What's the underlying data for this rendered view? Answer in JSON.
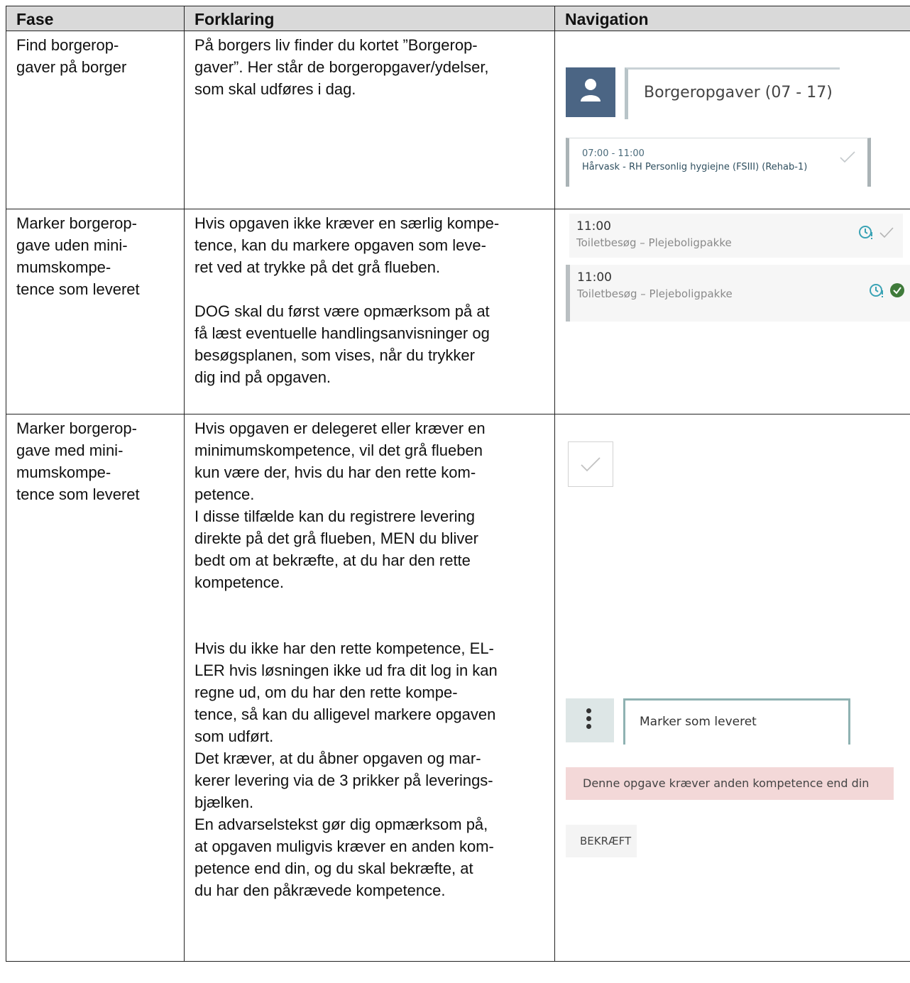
{
  "table": {
    "headers": [
      "Fase",
      "Forklaring",
      "Navigation"
    ],
    "rows": [
      {
        "fase": "Find borgerop-\ngaver på borger",
        "forklaring": [
          "På borgers liv finder du kortet ”Borgerop-\ngaver”. Her står de borgeropgaver/ydelser,\nsom skal udføres i dag."
        ]
      },
      {
        "fase": "Marker borgerop-\ngave uden mini-\nmumskompe-\ntence som leveret",
        "forklaring": [
          "Hvis opgaven ikke kræver en særlig kompe-\ntence, kan du markere opgaven som leve-\nret ved at trykke på det grå flueben.",
          "DOG skal du først være opmærksom på at\nfå læst eventuelle handlingsanvisninger og\nbesøgsplanen, som vises, når du trykker\ndig ind på opgaven."
        ]
      },
      {
        "fase": "Marker borgerop-\ngave med mini-\nmumskompe-\ntence som leveret",
        "forklaring": [
          "Hvis opgaven er delegeret eller kræver en\nminimumskompetence, vil det grå flueben\nkun være der, hvis du har den rette kom-\npetence.\nI disse tilfælde kan du registrere levering\ndirekte på det grå flueben, MEN du bliver\nbedt om at bekræfte, at du har den rette\nkompetence.",
          "Hvis du ikke har den rette kompetence, EL-\nLER hvis løsningen ikke ud fra dit log in kan\nregne ud, om du har den rette kompe-\ntence, så kan du alligevel markere opgaven\nsom udført.\nDet kræver, at du åbner opgaven og mar-\nkerer levering via de 3 prikker på leverings-\nbjælken.\nEn advarselstekst gør dig opmærksom på,\nat opgaven muligvis kræver en anden kom-\npetence end din, og du skal bekræfte, at\ndu har den påkrævede kompetence."
        ]
      }
    ]
  },
  "nav": {
    "borgeropgaver_title": "Borgeropgaver (07 -  17)",
    "task_time": "07:00 - 11:00",
    "task_name": "Hårvask - RH Personlig hygiejne (FSIII) (Rehab-1)",
    "visit_time": "11:00",
    "visit_name": "Toiletbesøg  – Plejeboligpakke",
    "marker_label": "Marker som leveret",
    "warning_text": "Denne opgave kræver anden kompetence end din",
    "confirm_label": "BEKRÆFT",
    "colors": {
      "avatar_bg": "#4b6584",
      "success_green": "#3f7a3a",
      "clock_teal": "#3aa3b5",
      "warning_bg": "#f3d8d8"
    }
  }
}
